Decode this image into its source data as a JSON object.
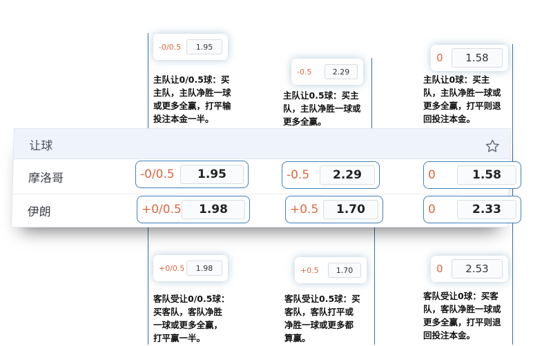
{
  "card": {
    "title": "让球",
    "teams": [
      "摩洛哥",
      "伊朗"
    ]
  },
  "odds": {
    "home": [
      {
        "line": "-0/0.5",
        "value": "1.95"
      },
      {
        "line": "-0.5",
        "value": "2.29"
      },
      {
        "line": "0",
        "value": "1.58"
      }
    ],
    "away": [
      {
        "line": "+0/0.5",
        "value": "1.98"
      },
      {
        "line": "+0.5",
        "value": "1.70"
      },
      {
        "line": "0",
        "value": "2.33"
      }
    ]
  },
  "callouts": {
    "top": [
      {
        "line": "-0/0.5",
        "value": "1.95",
        "text": "主队让0/0.5球：买\n主队，主队净胜一球\n或更多全赢，打平输\n投注本金一半。"
      },
      {
        "line": "-0.5",
        "value": "2.29",
        "text": "主队让0.5球：买主\n队，主队净胜一球或\n更多全赢。"
      },
      {
        "line": "0",
        "value": "1.58",
        "text": "主队让0球：买主\n队，主队净胜一球或\n更多全赢，打平则退\n回投注本金。"
      }
    ],
    "bottom": [
      {
        "line": "+0/0.5",
        "value": "1.98",
        "text": "客队受让0/0.5球：\n买客队，客队净胜\n一球或更多全赢，\n打平赢一半。"
      },
      {
        "line": "+0.5",
        "value": "1.70",
        "text": "客队受让0.5球：买\n客队，客队打平或\n净胜一球或更多都\n算赢。"
      },
      {
        "line": "0",
        "value": "2.53",
        "text": "客队受让0球：买客\n队，客队净胜一球或\n更多全赢，打平则退\n回投注本金。"
      }
    ]
  },
  "colors": {
    "accent_border": "#3d7fb9",
    "line_text": "#e0663f",
    "header_bg": "#eef3fc"
  },
  "icons": {
    "favorite": "star-icon"
  }
}
